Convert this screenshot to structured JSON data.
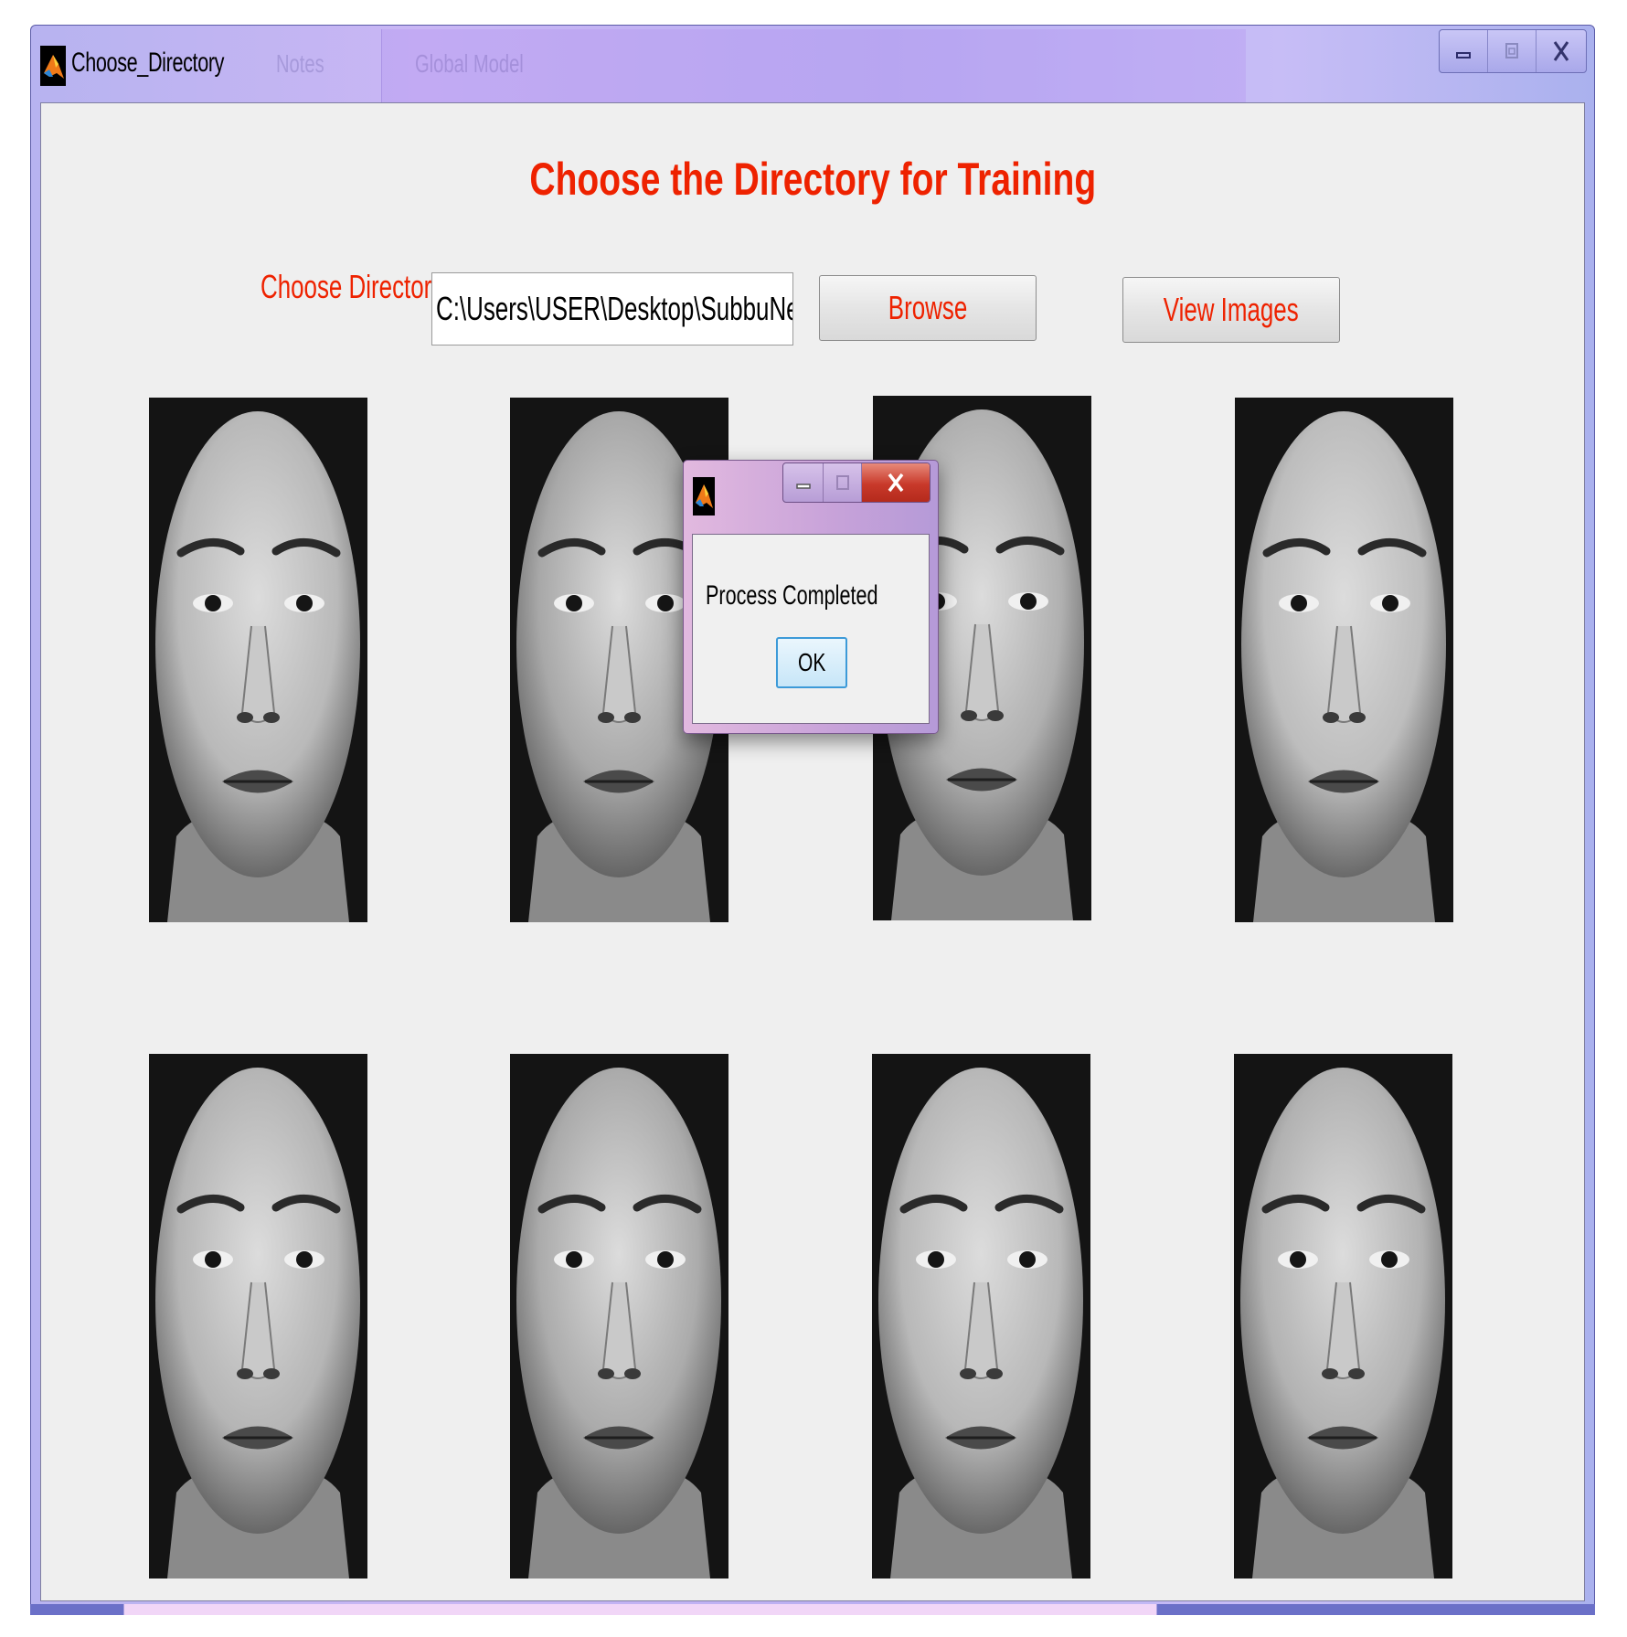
{
  "window": {
    "title": "Choose_Directory",
    "background_titles": [
      "Notes",
      "Global Model"
    ]
  },
  "form": {
    "heading": "Choose the Directory for Training",
    "directory_label": "Choose Directory",
    "directory_value": "C:\\Users\\USER\\Desktop\\SubbuNewFinal",
    "browse_label": "Browse",
    "view_images_label": "View Images"
  },
  "dialog": {
    "message": "Process Completed",
    "ok_label": "OK"
  },
  "images": [
    {
      "id": "face-1"
    },
    {
      "id": "face-2"
    },
    {
      "id": "face-3"
    },
    {
      "id": "face-4"
    },
    {
      "id": "face-5"
    },
    {
      "id": "face-6"
    },
    {
      "id": "face-7"
    },
    {
      "id": "face-8"
    }
  ],
  "colors": {
    "accent_text": "#ee2200",
    "client_bg": "#efefef",
    "titlebar": "#c4b8f3"
  }
}
